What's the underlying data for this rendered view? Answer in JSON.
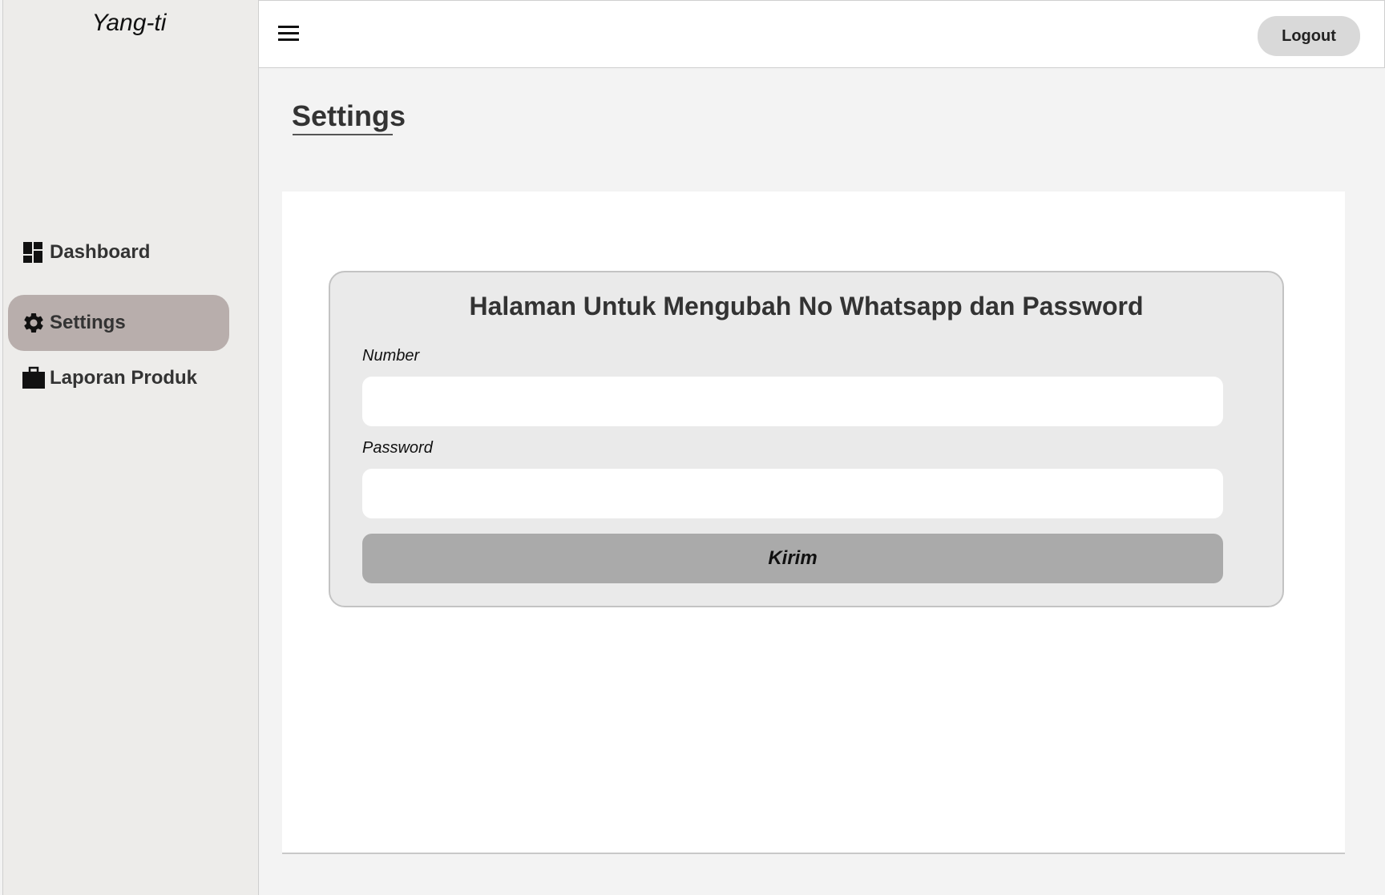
{
  "sidebar": {
    "brand": "Yang-ti",
    "items": [
      {
        "label": "Dashboard",
        "icon": "dashboard-icon",
        "active": false
      },
      {
        "label": "Settings",
        "icon": "gear-icon",
        "active": true
      },
      {
        "label": "Laporan Produk",
        "icon": "briefcase-icon",
        "active": false
      }
    ]
  },
  "header": {
    "menu_icon": "hamburger-menu-icon",
    "logout_label": "Logout"
  },
  "main": {
    "page_title": "Settings",
    "card": {
      "title": "Halaman Untuk Mengubah No Whatsapp dan Password",
      "number_label": "Number",
      "number_value": "",
      "password_label": "Password",
      "password_value": "",
      "submit_label": "Kirim"
    }
  },
  "colors": {
    "sidebar_bg": "#edecea",
    "active_item_bg": "#b8aeac",
    "card_bg": "#eaeaea",
    "submit_bg": "#aaaaaa",
    "logout_bg": "#d9d9d9"
  }
}
